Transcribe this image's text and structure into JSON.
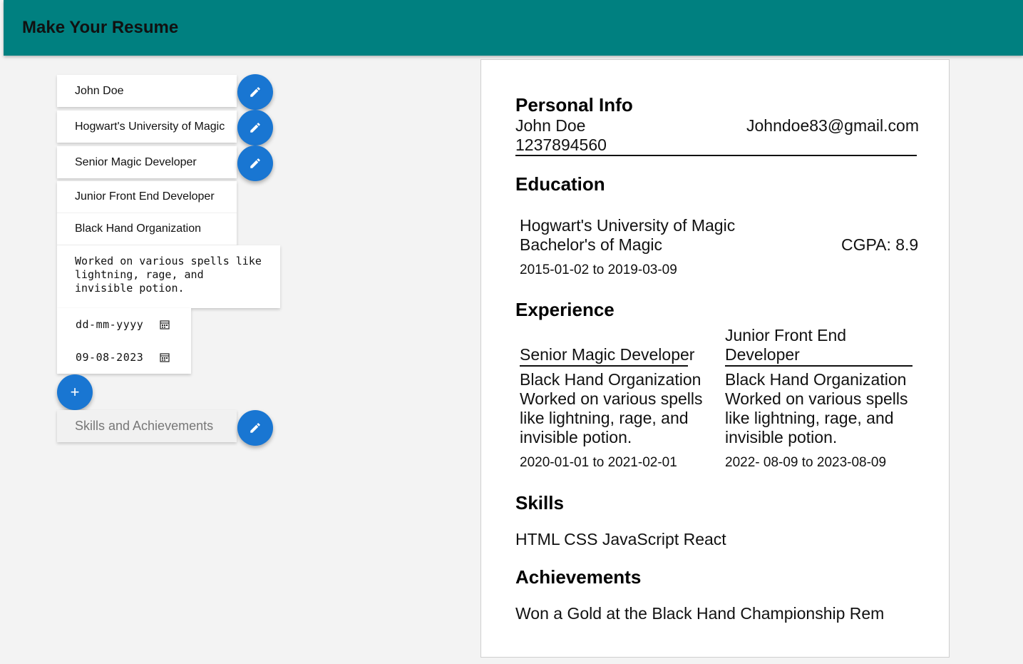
{
  "app": {
    "title": "Make Your Resume"
  },
  "form": {
    "name": "John Doe",
    "university": "Hogwart's University of Magic",
    "job_title": "Senior Magic Developer",
    "experience_title": "Junior Front End Developer",
    "organization": "Black Hand Organization",
    "description": "Worked on various spells like lightning, rage, and invisible potion.",
    "start_date_placeholder": "dd-mm-yyyy",
    "end_date": "09-08-2023",
    "skills_button": "Skills and Achievements",
    "add_symbol": "+"
  },
  "resume": {
    "personal_info": {
      "heading": "Personal Info",
      "name": "John Doe",
      "email": "Johndoe83@gmail.com",
      "phone": "1237894560"
    },
    "education": {
      "heading": "Education",
      "university": "Hogwart's University of Magic",
      "degree": "Bachelor's of Magic",
      "cgpa": "CGPA: 8.9",
      "dates": "2015-01-02 to 2019-03-09"
    },
    "experience": {
      "heading": "Experience",
      "items": [
        {
          "title": "Senior Magic Developer",
          "organization": "Black Hand Organization",
          "description": "Worked on various spells like lightning, rage, and invisible potion.",
          "dates": "2020-01-01 to 2021-02-01"
        },
        {
          "title": "Junior Front End Developer",
          "organization": "Black Hand Organization",
          "description": "Worked on various spells like lightning, rage, and invisible potion.",
          "dates": "2022- 08-09 to 2023-08-09"
        }
      ]
    },
    "skills": {
      "heading": "Skills",
      "text": "HTML CSS JavaScript React"
    },
    "achievements": {
      "heading": "Achievements",
      "text": "Won a Gold at the Black Hand Championship Rem"
    }
  },
  "colors": {
    "appbar": "#008080",
    "fab": "#1976d2",
    "background": "#f3f3f3"
  },
  "icons": {
    "edit": "pencil-icon",
    "add": "plus-icon",
    "calendar": "calendar-icon"
  }
}
